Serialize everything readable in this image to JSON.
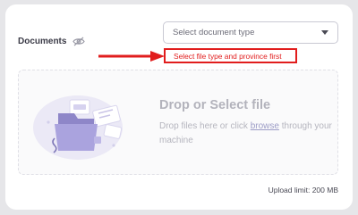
{
  "documents": {
    "label": "Documents",
    "visibility_icon": "eye-off-icon"
  },
  "type_select": {
    "placeholder": "Select document type",
    "icon": "chevron-down-icon"
  },
  "error": {
    "message": "Select file type and province first",
    "color": "#e11d1d"
  },
  "dropzone": {
    "title": "Drop or Select file",
    "desc_before": "Drop files here or click ",
    "browse_link": "browse",
    "desc_after": " through your machine",
    "illustration": "folder-upload-illustration"
  },
  "upload_limit": "Upload limit: 200 MB"
}
